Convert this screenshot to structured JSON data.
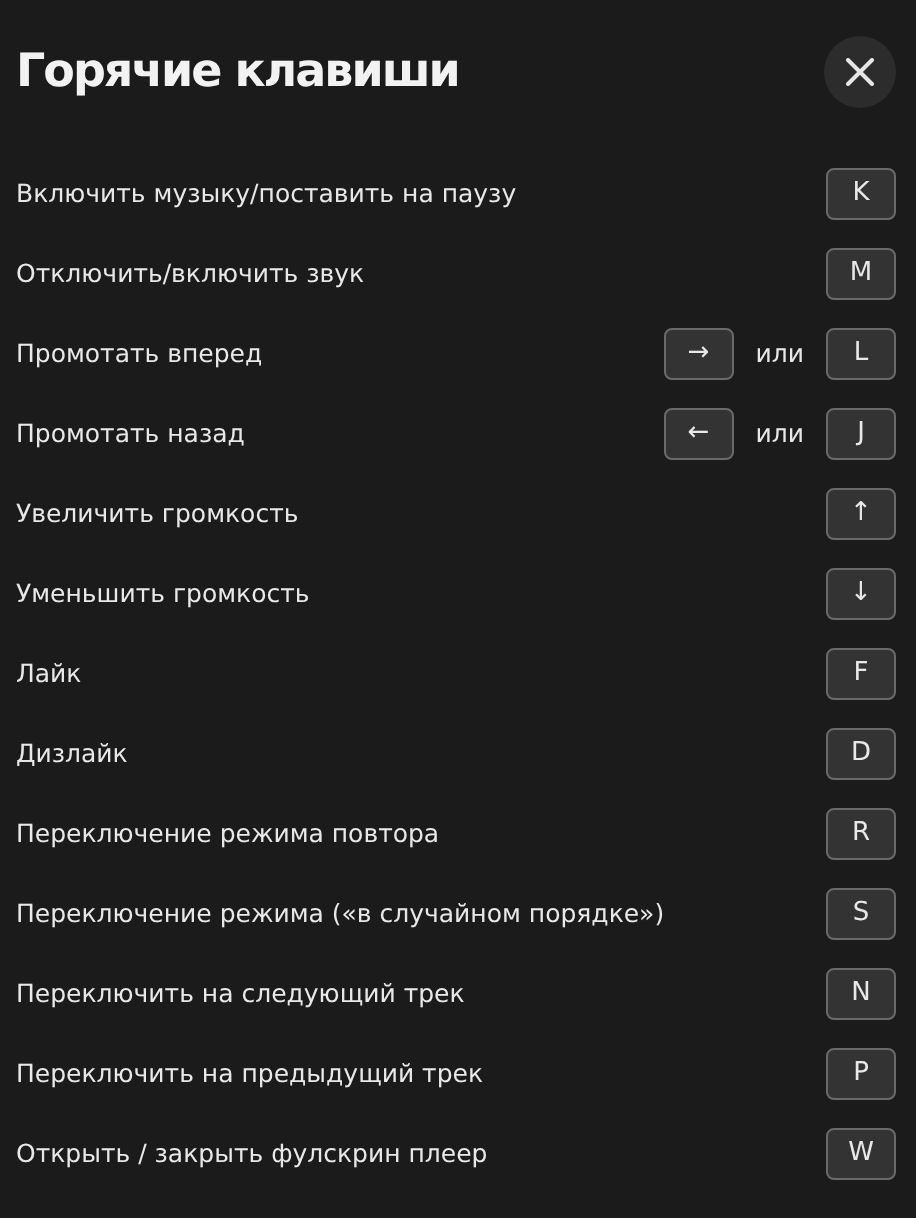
{
  "title": "Горячие клавиши",
  "shortcuts": [
    {
      "action": "Включить музыку/поставить на паузу",
      "keys": [
        "K"
      ]
    },
    {
      "action": "Отключить/включить звук",
      "keys": [
        "M"
      ]
    },
    {
      "action": "Промотать вперед",
      "keys": [
        "→",
        "L"
      ],
      "separator": "или"
    },
    {
      "action": "Промотать назад",
      "keys": [
        "←",
        "J"
      ],
      "separator": "или"
    },
    {
      "action": "Увеличить громкость",
      "keys": [
        "↑"
      ]
    },
    {
      "action": "Уменьшить громкость",
      "keys": [
        "↓"
      ]
    },
    {
      "action": "Лайк",
      "keys": [
        "F"
      ]
    },
    {
      "action": "Дизлайк",
      "keys": [
        "D"
      ]
    },
    {
      "action": "Переключение режима повтора",
      "keys": [
        "R"
      ]
    },
    {
      "action": "Переключение режима («в случайном порядке»)",
      "keys": [
        "S"
      ]
    },
    {
      "action": "Переключить на следующий трек",
      "keys": [
        "N"
      ]
    },
    {
      "action": "Переключить на предыдущий трек",
      "keys": [
        "P"
      ]
    },
    {
      "action": "Открыть / закрыть фулскрин плеер",
      "keys": [
        "W"
      ]
    }
  ]
}
